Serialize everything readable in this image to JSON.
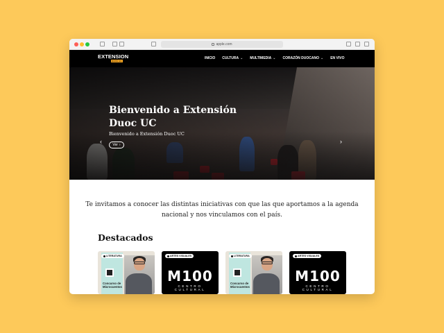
{
  "browser": {
    "address": "apple.com"
  },
  "nav": {
    "logo_text": "EXTENSION",
    "logo_sub": "DUOC UC",
    "items": [
      {
        "label": "INICIO",
        "dropdown": false
      },
      {
        "label": "CULTURA",
        "dropdown": true
      },
      {
        "label": "MULTIMEDIA",
        "dropdown": true
      },
      {
        "label": "CORAZÓN DUOCANO",
        "dropdown": true
      },
      {
        "label": "EN VIVO",
        "dropdown": false
      }
    ]
  },
  "hero": {
    "title": "Bienvenido a Extensión Duoc UC",
    "subtitle": "Bienvenido a Extensión Duoc UC",
    "button_label": "Ver"
  },
  "intro": {
    "text": "Te invitamos a conocer las distintas iniciativas con que las que aportamos a la agenda nacional y nos vinculamos con el país."
  },
  "featured": {
    "heading": "Destacados",
    "cards": [
      {
        "type": "lit",
        "badge": "LITERATURA",
        "title": "Concurso de Microcuentos"
      },
      {
        "type": "art",
        "badge": "ARTES VISUALES",
        "title": "M100",
        "subtitle": "CENTRO CULTURAL"
      },
      {
        "type": "lit",
        "badge": "LITERATURA",
        "title": "Concurso de Microcuentos"
      },
      {
        "type": "art",
        "badge": "ARTES VISUALES",
        "title": "M100",
        "subtitle": "CENTRO CULTURAL"
      }
    ]
  },
  "colors": {
    "background": "#fdc95a",
    "nav": "#000000",
    "accent": "#f5a623"
  }
}
